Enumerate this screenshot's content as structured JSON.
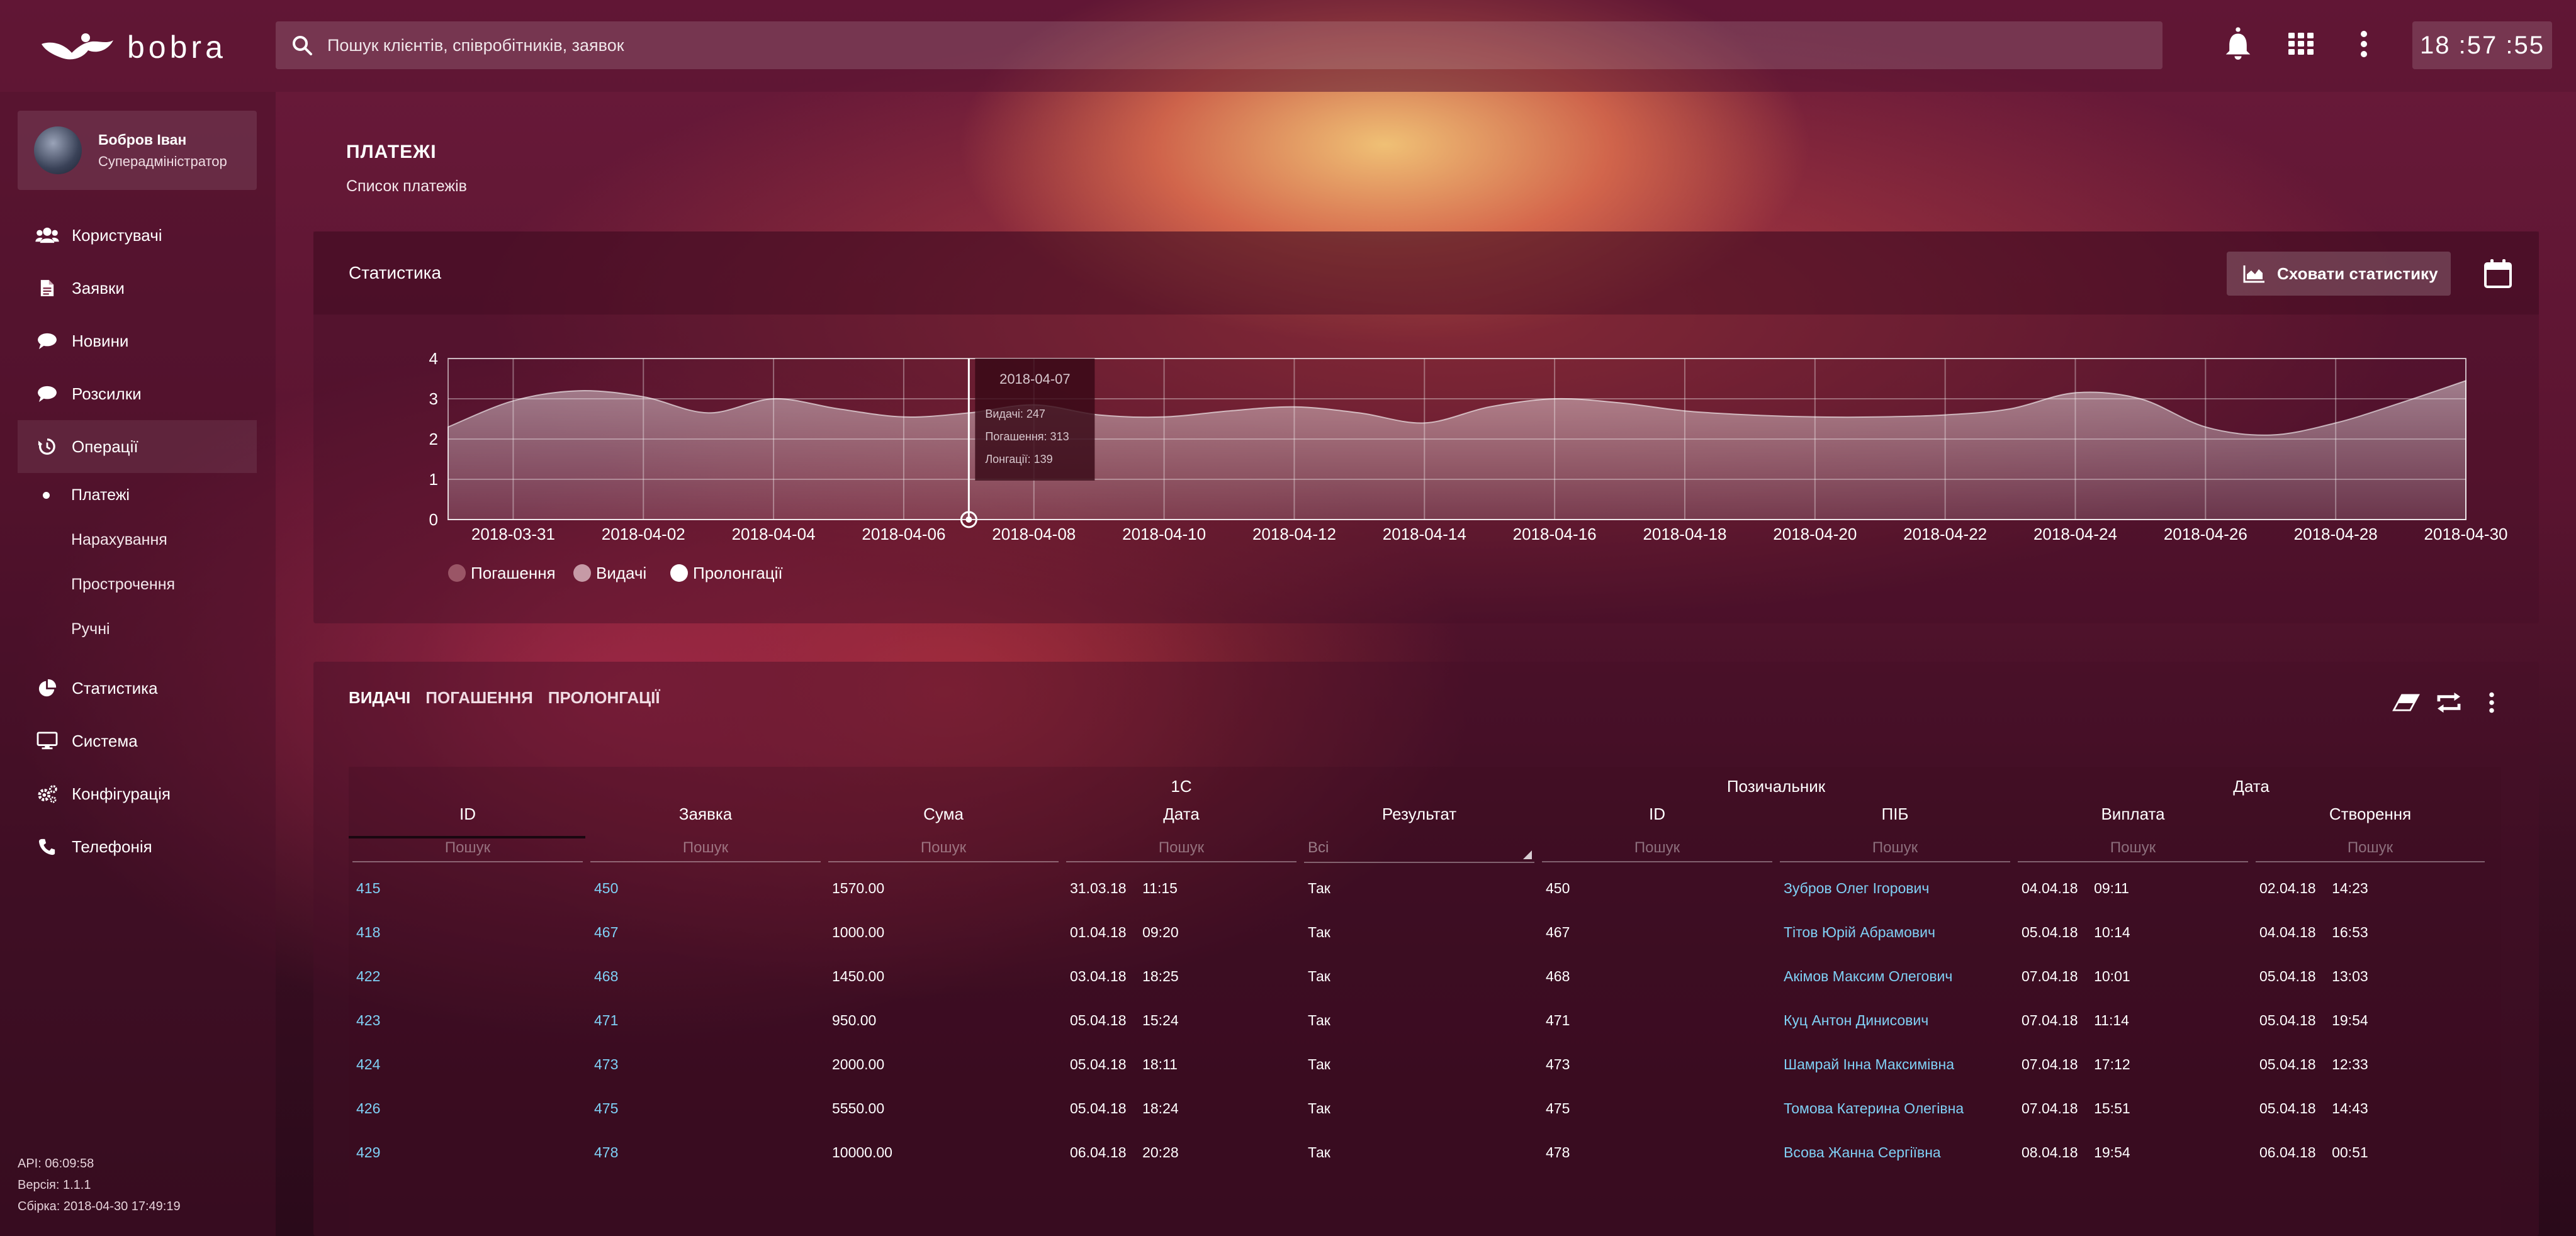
{
  "app": {
    "logo_text": "bobra"
  },
  "search": {
    "placeholder": "Пошук клієнтів, співробітників, заявок"
  },
  "clock": "18 :57 :55",
  "profile": {
    "name": "Бобров Іван",
    "role": "Суперадміністратор"
  },
  "sidebar": {
    "items": [
      {
        "label": "Користувачі",
        "icon": "users-icon"
      },
      {
        "label": "Заявки",
        "icon": "document-icon"
      },
      {
        "label": "Новини",
        "icon": "comment-icon"
      },
      {
        "label": "Розсилки",
        "icon": "comment-icon"
      },
      {
        "label": "Операції",
        "icon": "history-icon",
        "active": true
      }
    ],
    "subitems": [
      {
        "label": "Платежі",
        "current": true
      },
      {
        "label": "Нарахування"
      },
      {
        "label": "Прострочення"
      },
      {
        "label": "Ручні"
      }
    ],
    "items_bottom": [
      {
        "label": "Статистика",
        "icon": "pie-chart-icon"
      },
      {
        "label": "Система",
        "icon": "monitor-icon"
      },
      {
        "label": "Конфігурація",
        "icon": "gears-icon"
      },
      {
        "label": "Телефонія",
        "icon": "phone-icon"
      }
    ]
  },
  "build": {
    "api": "API: 06:09:58",
    "version": "Версія: 1.1.1",
    "build": "Сбірка: 2018-04-30 17:49:19"
  },
  "page": {
    "title": "ПЛАТЕЖІ",
    "subtitle": "Список платежів"
  },
  "stats": {
    "title": "Статистика",
    "hide_button": "Сховати статистику"
  },
  "chart_data": {
    "type": "area",
    "x_tick_labels": [
      "2018-03-31",
      "2018-04-02",
      "2018-04-04",
      "2018-04-06",
      "2018-04-08",
      "2018-04-10",
      "2018-04-12",
      "2018-04-14",
      "2018-04-16",
      "2018-04-18",
      "2018-04-20",
      "2018-04-22",
      "2018-04-24",
      "2018-04-26",
      "2018-04-28",
      "2018-04-30"
    ],
    "y_ticks": [
      0,
      1,
      2,
      3,
      4
    ],
    "ylim": [
      0,
      4
    ],
    "x_range": [
      "2018-03-30",
      "2018-04-30"
    ],
    "grid": true,
    "legend_position": "bottom-left",
    "series": [
      {
        "name": "Погашення",
        "color": "#9a5566",
        "active": false
      },
      {
        "name": "Видачі",
        "color": "#c69aa6",
        "active": false
      },
      {
        "name": "Пролонгації",
        "color": "#ffffff",
        "active": true
      }
    ],
    "curve": {
      "x": [
        "2018-03-30",
        "2018-03-31",
        "2018-04-01",
        "2018-04-02",
        "2018-04-03",
        "2018-04-04",
        "2018-04-05",
        "2018-04-06",
        "2018-04-07",
        "2018-04-08",
        "2018-04-09",
        "2018-04-10",
        "2018-04-11",
        "2018-04-12",
        "2018-04-13",
        "2018-04-14",
        "2018-04-15",
        "2018-04-16",
        "2018-04-17",
        "2018-04-18",
        "2018-04-19",
        "2018-04-20",
        "2018-04-21",
        "2018-04-22",
        "2018-04-23",
        "2018-04-24",
        "2018-04-25",
        "2018-04-26",
        "2018-04-27",
        "2018-04-28",
        "2018-04-29",
        "2018-04-30"
      ],
      "y": [
        2.3,
        2.95,
        3.2,
        3.05,
        2.65,
        3.0,
        2.75,
        2.55,
        2.65,
        2.85,
        2.6,
        2.55,
        2.7,
        2.8,
        2.65,
        2.4,
        2.8,
        3.0,
        2.9,
        2.7,
        2.6,
        2.55,
        2.55,
        2.6,
        2.75,
        3.15,
        3.0,
        2.3,
        2.1,
        2.4,
        2.9,
        3.45
      ]
    },
    "tooltip": {
      "date": "2018-04-07",
      "lines": [
        "Видачі: 247",
        "Погашення: 313",
        "Лонгації: 139"
      ]
    }
  },
  "table": {
    "tabs": [
      "ВИДАЧІ",
      "ПОГАШЕННЯ",
      "ПРОЛОНГАЦІЇ"
    ],
    "active_tab": 0,
    "groups": [
      {
        "label": "",
        "span": 2
      },
      {
        "label": "1С",
        "span": 3
      },
      {
        "label": "Позичальник",
        "span": 2
      },
      {
        "label": "Дата",
        "span": 2
      }
    ],
    "columns": [
      "ID",
      "Заявка",
      "Сума",
      "Дата",
      "Результат",
      "ID",
      "ПІБ",
      "Виплата",
      "Створення"
    ],
    "filter_placeholder": "Пошук",
    "filter_select": "Всі",
    "rows": [
      [
        "415",
        "450",
        "1570.00",
        "31.03.18    11:15",
        "Так",
        "450",
        "Зубров Олег Ігорович",
        "04.04.18    09:11",
        "02.04.18    14:23"
      ],
      [
        "418",
        "467",
        "1000.00",
        "01.04.18    09:20",
        "Так",
        "467",
        "Тітов Юрій Абрамович",
        "05.04.18    10:14",
        "04.04.18    16:53"
      ],
      [
        "422",
        "468",
        "1450.00",
        "03.04.18    18:25",
        "Так",
        "468",
        "Акімов Максим Олегович",
        "07.04.18    10:01",
        "05.04.18    13:03"
      ],
      [
        "423",
        "471",
        "950.00",
        "05.04.18    15:24",
        "Так",
        "471",
        "Куц Антон Динисович",
        "07.04.18    11:14",
        "05.04.18    19:54"
      ],
      [
        "424",
        "473",
        "2000.00",
        "05.04.18    18:11",
        "Так",
        "473",
        "Шамрай Інна Максимівна",
        "07.04.18    17:12",
        "05.04.18    12:33"
      ],
      [
        "426",
        "475",
        "5550.00",
        "05.04.18    18:24",
        "Так",
        "475",
        "Томова Катерина Олегівна",
        "07.04.18    15:51",
        "05.04.18    14:43"
      ],
      [
        "429",
        "478",
        "10000.00",
        "06.04.18    20:28",
        "Так",
        "478",
        "Всова Жанна Сергіївна",
        "08.04.18    19:54",
        "06.04.18    00:51"
      ]
    ],
    "link_columns": [
      0,
      1,
      6
    ]
  }
}
